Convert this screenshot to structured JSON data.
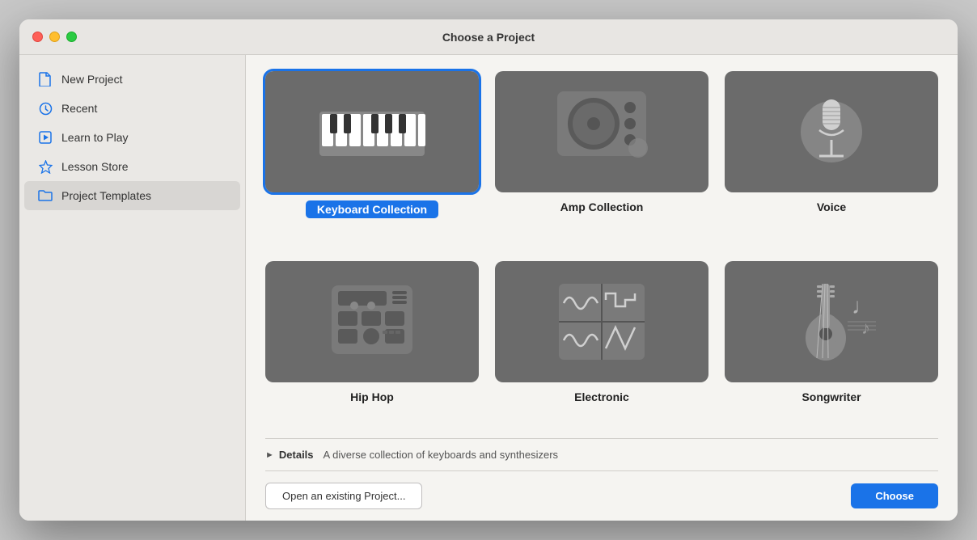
{
  "window": {
    "title": "Choose a Project"
  },
  "traffic_lights": {
    "close_label": "close",
    "minimize_label": "minimize",
    "maximize_label": "maximize"
  },
  "sidebar": {
    "items": [
      {
        "id": "new-project",
        "label": "New Project",
        "icon": "doc-icon",
        "active": false
      },
      {
        "id": "recent",
        "label": "Recent",
        "icon": "clock-icon",
        "active": false
      },
      {
        "id": "learn-to-play",
        "label": "Learn to Play",
        "icon": "play-icon",
        "active": false
      },
      {
        "id": "lesson-store",
        "label": "Lesson Store",
        "icon": "star-icon",
        "active": false
      },
      {
        "id": "project-templates",
        "label": "Project Templates",
        "icon": "folder-icon",
        "active": true
      }
    ]
  },
  "templates": {
    "items": [
      {
        "id": "keyboard-collection",
        "label": "Keyboard Collection",
        "selected": true
      },
      {
        "id": "amp-collection",
        "label": "Amp Collection",
        "selected": false
      },
      {
        "id": "voice",
        "label": "Voice",
        "selected": false
      },
      {
        "id": "hip-hop",
        "label": "Hip Hop",
        "selected": false
      },
      {
        "id": "electronic",
        "label": "Electronic",
        "selected": false
      },
      {
        "id": "songwriter",
        "label": "Songwriter",
        "selected": false
      }
    ]
  },
  "details": {
    "toggle_label": "Details",
    "description": "A diverse collection of keyboards and synthesizers"
  },
  "footer": {
    "open_label": "Open an existing Project...",
    "choose_label": "Choose"
  }
}
